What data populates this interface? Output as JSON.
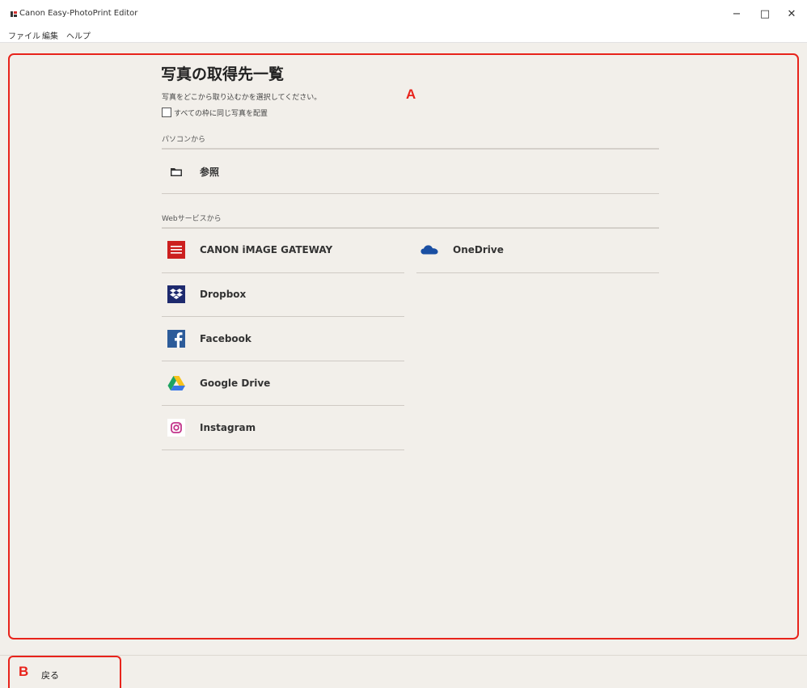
{
  "window": {
    "title": "Canon Easy-PhotoPrint Editor",
    "controls": {
      "minimize": "−",
      "maximize": "□",
      "close": "✕"
    }
  },
  "menu": [
    "ファイル",
    "編集",
    "ヘルプ"
  ],
  "main": {
    "title": "写真の取得先一覧",
    "instruction": "写真をどこから取り込むかを選択してください。",
    "checkbox": {
      "label": "すべての枠に同じ写真を配置",
      "checked": false
    },
    "callout_a": "A",
    "pc_section": {
      "label": "パソコンから",
      "items": [
        {
          "label": "参照",
          "icon": "folder-icon"
        }
      ]
    },
    "web_section": {
      "label": "Webサービスから",
      "left_items": [
        {
          "label": "CANON iMAGE GATEWAY",
          "icon": "canon-image-gateway-icon"
        },
        {
          "label": "Dropbox",
          "icon": "dropbox-icon"
        },
        {
          "label": "Facebook",
          "icon": "facebook-icon"
        },
        {
          "label": "Google Drive",
          "icon": "google-drive-icon"
        },
        {
          "label": "Instagram",
          "icon": "instagram-icon"
        }
      ],
      "right_items": [
        {
          "label": "OneDrive",
          "icon": "onedrive-icon"
        }
      ]
    }
  },
  "footer": {
    "callout_b": "B",
    "back_label": "戻る"
  },
  "colors": {
    "callout_red": "#e8231b",
    "background": "#f2efea",
    "canon_red": "#cc1f1f",
    "dropbox_navy": "#1e2a6e",
    "facebook_blue": "#2d5c9a",
    "onedrive_blue": "#1a4fa3"
  }
}
